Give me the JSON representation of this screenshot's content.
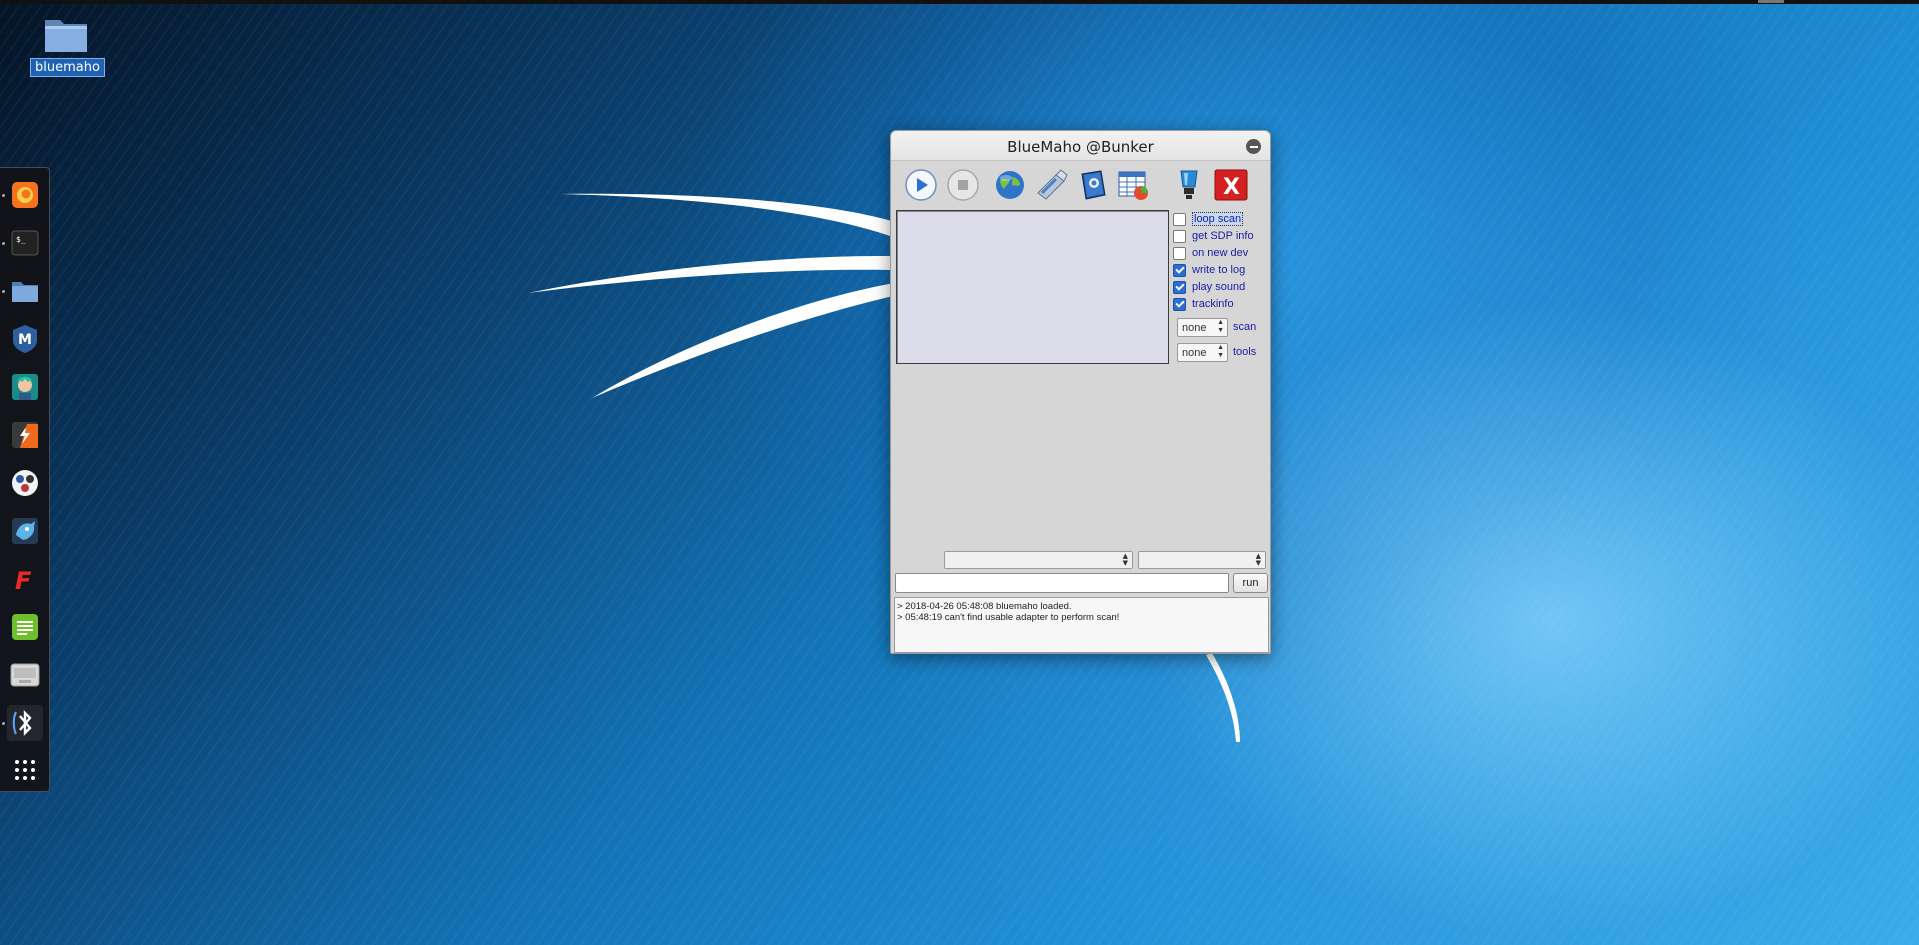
{
  "desktop": {
    "icons": [
      {
        "label": "bluemaho",
        "icon": "folder-icon"
      }
    ]
  },
  "dock": {
    "items": [
      {
        "name": "firefox",
        "icon": "firefox-icon"
      },
      {
        "name": "terminal",
        "icon": "terminal-icon",
        "glyph": "$_"
      },
      {
        "name": "files",
        "icon": "folder-icon"
      },
      {
        "name": "metasploit",
        "icon": "metasploit-icon",
        "glyph": "M"
      },
      {
        "name": "armitage",
        "icon": "armitage-icon"
      },
      {
        "name": "burpsuite",
        "icon": "burp-icon",
        "glyph": "⚡"
      },
      {
        "name": "maltego",
        "icon": "maltego-icon"
      },
      {
        "name": "beef",
        "icon": "beef-icon"
      },
      {
        "name": "faraday",
        "icon": "faraday-icon",
        "glyph": "F"
      },
      {
        "name": "leafpad",
        "icon": "text-editor-icon"
      },
      {
        "name": "keyboard",
        "icon": "keyboard-icon"
      },
      {
        "name": "bluemaho",
        "icon": "bluetooth-icon",
        "glyph": "✱"
      },
      {
        "name": "show-apps",
        "icon": "app-grid-icon"
      }
    ]
  },
  "window": {
    "title": "BlueMaho @Bunker",
    "toolbar": [
      {
        "name": "play",
        "icon": "play-icon"
      },
      {
        "name": "stop",
        "icon": "stop-icon"
      },
      {
        "name": "network",
        "icon": "globe-icon"
      },
      {
        "name": "adapter",
        "icon": "usb-adapter-icon"
      },
      {
        "name": "log",
        "icon": "book-icon"
      },
      {
        "name": "table",
        "icon": "table-chart-icon"
      },
      {
        "name": "info",
        "icon": "lamp-icon"
      },
      {
        "name": "exit",
        "icon": "close-x-icon",
        "glyph": "X"
      }
    ],
    "options": [
      {
        "label": "loop scan",
        "checked": false
      },
      {
        "label": "get SDP info",
        "checked": false
      },
      {
        "label": "on new dev",
        "checked": false
      },
      {
        "label": "write to log",
        "checked": true
      },
      {
        "label": "play sound",
        "checked": true
      },
      {
        "label": "trackinfo",
        "checked": true
      }
    ],
    "spinners": [
      {
        "value": "none",
        "label": "scan"
      },
      {
        "value": "none",
        "label": "tools"
      }
    ],
    "command": {
      "value": "",
      "run_label": "run"
    },
    "log": [
      "> 2018-04-26 05:48:08 bluemaho loaded.",
      "> 05:48:19 can't find usable adapter to perform scan!"
    ]
  },
  "colors": {
    "accent": "#2a6fd6",
    "option_text": "#1a1aa8",
    "exit_red": "#d62020"
  }
}
